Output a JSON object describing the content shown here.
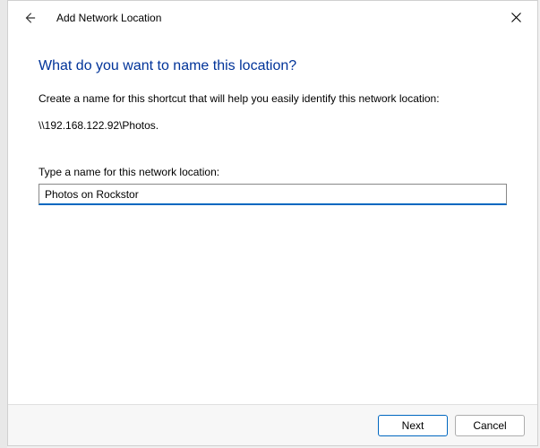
{
  "window": {
    "title": "Add Network Location"
  },
  "content": {
    "heading": "What do you want to name this location?",
    "description": "Create a name for this shortcut that will help you easily identify this network location:",
    "path": "\\\\192.168.122.92\\Photos.",
    "input_label": "Type a name for this network location:",
    "input_value": "Photos on Rockstor"
  },
  "footer": {
    "next_label": "Next",
    "cancel_label": "Cancel"
  }
}
